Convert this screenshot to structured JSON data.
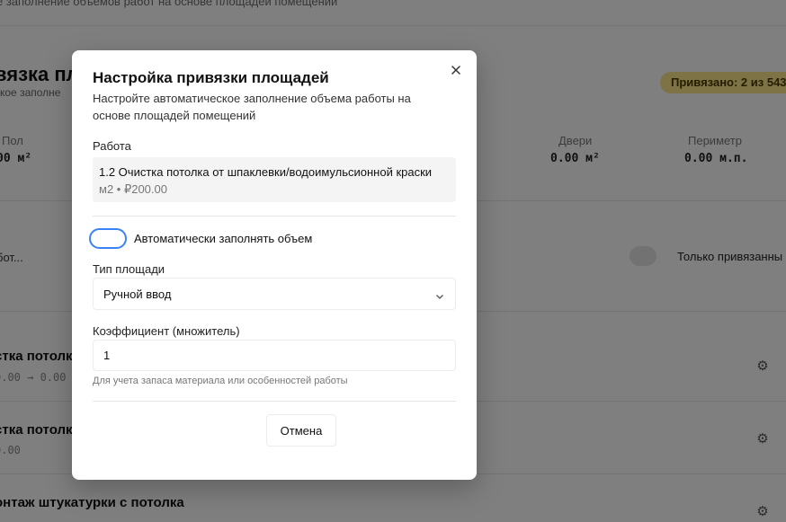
{
  "background": {
    "topbar_text": "е заполнение объемов работ на основе площадей помещений",
    "page_title": "вязка пл",
    "page_subtitle": "ское заполне",
    "badge": "Привязано: 2 из 543",
    "stats": [
      {
        "label": "Пол",
        "value": "00 м²"
      },
      {
        "label": "Двери",
        "value": "0.00 м²"
      },
      {
        "label": "Периметр",
        "value": "0.00 м.п."
      }
    ],
    "filter_text": "бот...",
    "only_bound_label": "Только привязанны",
    "rows": [
      {
        "title": "стка потолк",
        "sub": "0.00 → 0.00"
      },
      {
        "title": "стка потолк",
        "sub": "0.00"
      },
      {
        "title": "онтаж штукатурки с потолка",
        "sub": ""
      }
    ]
  },
  "modal": {
    "title": "Настройка привязки площадей",
    "description": "Настройте автоматическое заполнение объема работы на основе площадей помещений",
    "work_label": "Работа",
    "work_name": "1.2 Очистка потолка от шпаклевки/водоимульсионной краски",
    "work_meta": "м2 • ₽200.00",
    "auto_fill_label": "Автоматически заполнять объем",
    "area_type_label": "Тип площади",
    "area_type_value": "Ручной ввод",
    "coef_label": "Коэффициент (множитель)",
    "coef_value": "1",
    "coef_hint": "Для учета запаса материала или особенностей работы",
    "cancel_label": "Отмена"
  },
  "colors": {
    "accent": "#3b82f6",
    "badge_bg": "#fde68a",
    "overlay": "rgba(0,0,0,0.5)"
  },
  "icons": {
    "close": "close-icon",
    "chevron": "chevron-down-icon",
    "gear": "gear-icon"
  }
}
